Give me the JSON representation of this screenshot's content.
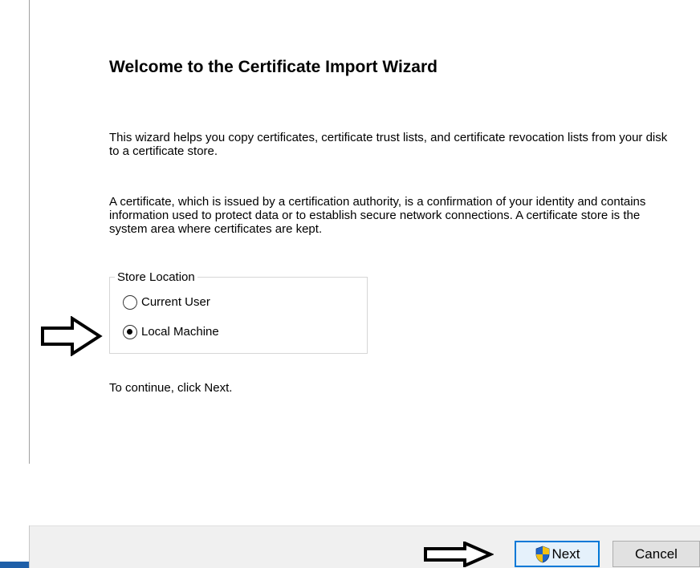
{
  "wizard": {
    "title": "Welcome to the Certificate Import Wizard",
    "intro_text": "This wizard helps you copy certificates, certificate trust lists, and certificate revocation lists from your disk to a certificate store.",
    "description_text": "A certificate, which is issued by a certification authority, is a confirmation of your identity and contains information used to protect data or to establish secure network connections. A certificate store is the system area where certificates are kept.",
    "continue_text": "To continue, click Next."
  },
  "store_location": {
    "legend": "Store Location",
    "options": [
      {
        "label": "Current User",
        "selected": false
      },
      {
        "label": "Local Machine",
        "selected": true
      }
    ]
  },
  "footer": {
    "next_label": "Next",
    "cancel_label": "Cancel"
  },
  "icons": {
    "next_button_icon": "uac-shield-icon",
    "annotation_arrows": "outline-arrow-right-icon"
  },
  "colors": {
    "focus_border": "#0078d7",
    "shield_blue": "#1e64c8",
    "shield_yellow": "#f3c012",
    "footer_bg": "#f0f0f0"
  }
}
